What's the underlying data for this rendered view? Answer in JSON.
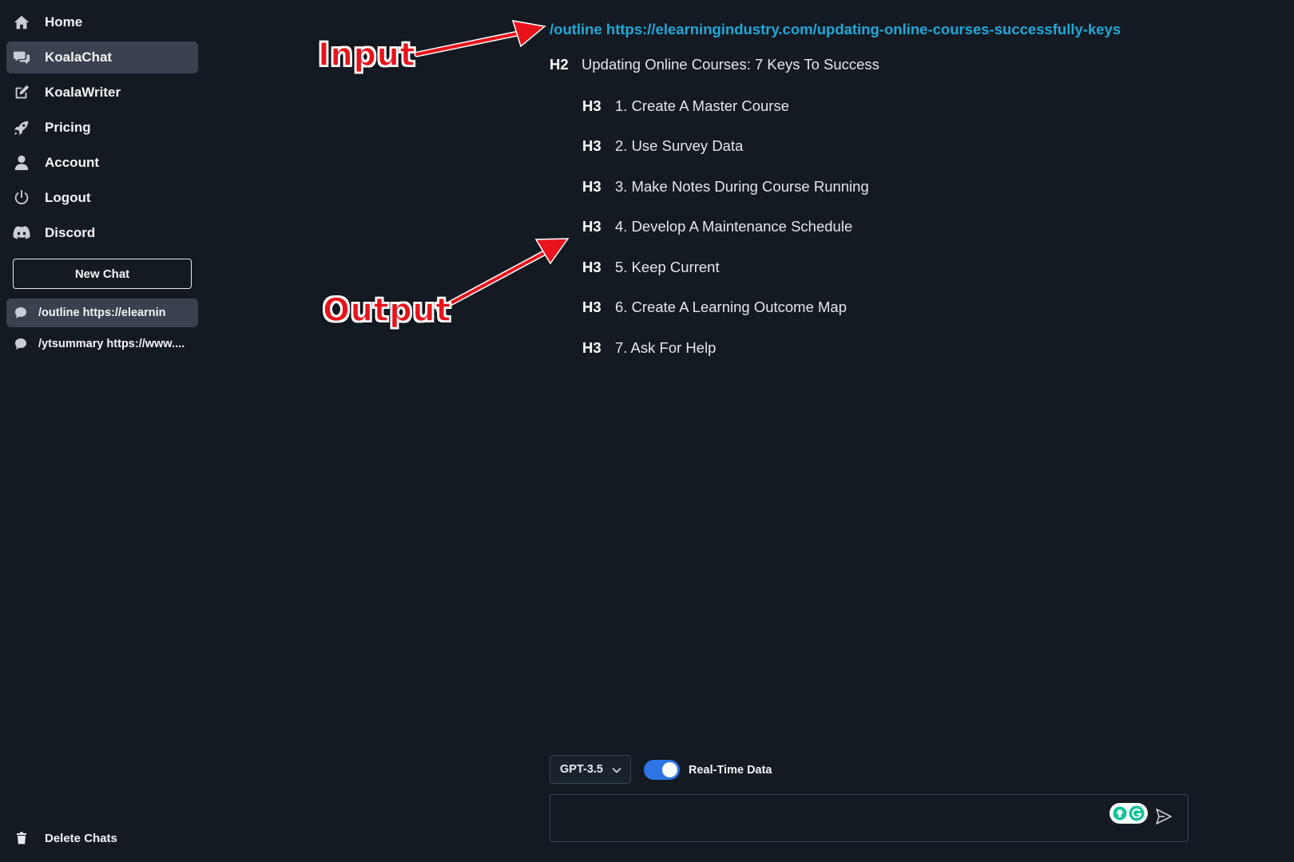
{
  "sidebar": {
    "nav": [
      {
        "label": "Home",
        "icon": "home-icon",
        "active": false
      },
      {
        "label": "KoalaChat",
        "icon": "chat-bubbles-icon",
        "active": true
      },
      {
        "label": "KoalaWriter",
        "icon": "edit-icon",
        "active": false
      },
      {
        "label": "Pricing",
        "icon": "rocket-icon",
        "active": false
      },
      {
        "label": "Account",
        "icon": "user-icon",
        "active": false
      },
      {
        "label": "Logout",
        "icon": "power-icon",
        "active": false
      },
      {
        "label": "Discord",
        "icon": "discord-icon",
        "active": false
      }
    ],
    "new_chat_label": "New Chat",
    "history": [
      {
        "label": "/outline https://elearnin",
        "icon": "chat-bubble-icon",
        "active": true
      },
      {
        "label": "/ytsummary https://www....",
        "icon": "chat-bubble-icon",
        "active": false
      }
    ],
    "delete_chats_label": "Delete Chats"
  },
  "conversation": {
    "input_text": "/outline https://elearningindustry.com/updating-online-courses-successfully-keys",
    "output": {
      "h2": {
        "tag": "H2",
        "text": "Updating Online Courses: 7 Keys To Success"
      },
      "h3": [
        {
          "tag": "H3",
          "text": "1. Create A Master Course"
        },
        {
          "tag": "H3",
          "text": "2. Use Survey Data"
        },
        {
          "tag": "H3",
          "text": "3. Make Notes During Course Running"
        },
        {
          "tag": "H3",
          "text": "4. Develop A Maintenance Schedule"
        },
        {
          "tag": "H3",
          "text": "5. Keep Current"
        },
        {
          "tag": "H3",
          "text": "6. Create A Learning Outcome Map"
        },
        {
          "tag": "H3",
          "text": "7. Ask For Help"
        }
      ]
    }
  },
  "annotations": {
    "input_label": "Input",
    "output_label": "Output",
    "color": "#e8131b"
  },
  "composer": {
    "model": "GPT-3.5",
    "realtime_label": "Real-Time Data",
    "realtime_enabled": true,
    "message_value": ""
  },
  "colors": {
    "background": "#131a22",
    "active_item": "#3a4250",
    "link": "#20a7d8",
    "toggle": "#2f74e6"
  }
}
